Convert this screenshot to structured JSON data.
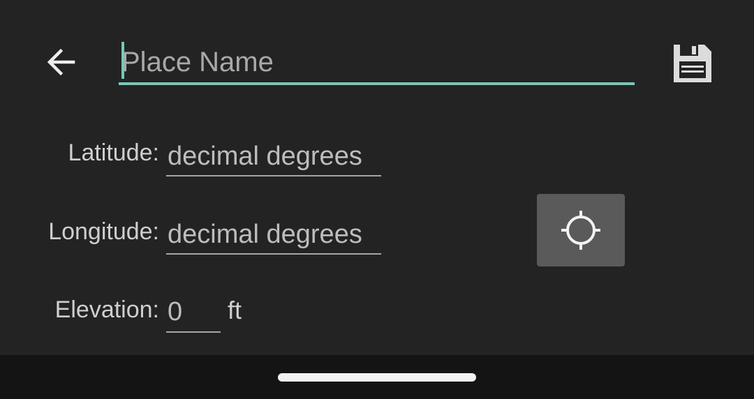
{
  "header": {
    "place_name_placeholder": "Place Name",
    "place_name_value": ""
  },
  "form": {
    "latitude_label": "Latitude:",
    "latitude_placeholder": "decimal degrees",
    "longitude_label": "Longitude:",
    "longitude_placeholder": "decimal degrees",
    "elevation_label": "Elevation:",
    "elevation_value": "0",
    "elevation_unit": "ft"
  },
  "icons": {
    "back": "arrow-left-icon",
    "save": "floppy-disk-icon",
    "locate": "crosshair-icon"
  },
  "colors": {
    "background": "#232323",
    "accent": "#74c9bb",
    "button_bg": "#5a5a5a",
    "nav_bar": "#141414"
  }
}
